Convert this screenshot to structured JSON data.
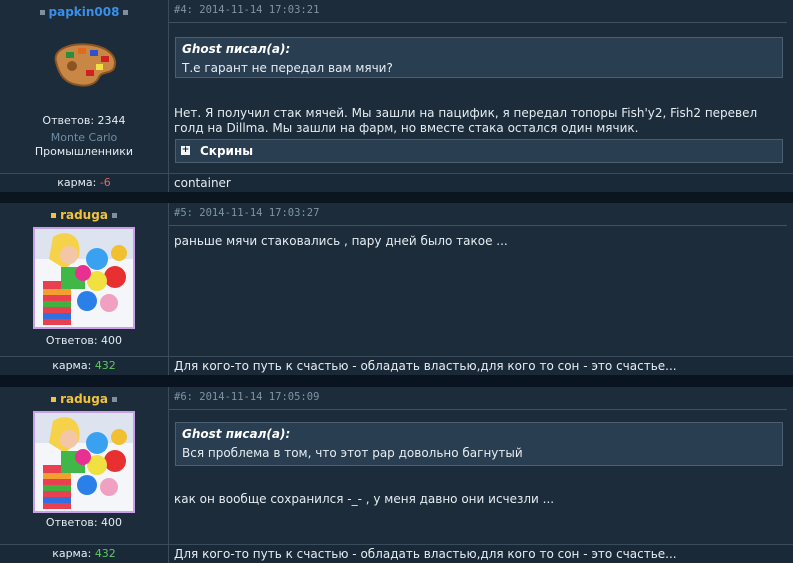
{
  "posts": [
    {
      "username": "papkin008",
      "username_color": "#3a8fe8",
      "avatar_icon": "palette-icon",
      "replies_label": "Ответов: 2344",
      "location": "Monte Carlo",
      "group": "Промышленники",
      "karma_label": "карма:",
      "karma_value": "-6",
      "karma_color": "#e06a60",
      "header": "#4: 2014-11-14 17:03:21",
      "quote": {
        "author": "Ghost писал(а):",
        "text": "Т.е гарант не передал вам мячи?"
      },
      "body": "Нет. Я получил стак мячей. Мы зашли на пацифик, я передал топоры Fish'y2, Fish2 перевел голд на Dillma. Мы зашли на фарм, но вместе стака остался один мячик.",
      "spoiler": "Скрины",
      "signature": "container"
    },
    {
      "username": "raduga",
      "username_color": "#f2c33a",
      "avatar_icon": "girl-with-balloons-avatar",
      "replies_label": "Ответов: 400",
      "karma_label": "карма:",
      "karma_value": "432",
      "karma_color": "#5ec85e",
      "header": "#5: 2014-11-14 17:03:27",
      "body": "раньше мячи стаковались , пару дней было такое ...",
      "signature": "Для кого-то путь к счастью - обладать властью,для кого то сон - это счастье..."
    },
    {
      "username": "raduga",
      "username_color": "#f2c33a",
      "avatar_icon": "girl-with-balloons-avatar",
      "replies_label": "Ответов: 400",
      "karma_label": "карма:",
      "karma_value": "432",
      "karma_color": "#5ec85e",
      "header": "#6: 2014-11-14 17:05:09",
      "quote": {
        "author": "Ghost писал(а):",
        "text": "Вся проблема в том, что этот рар довольно багнутый"
      },
      "body": "как он вообще сохранился -_- , у меня давно они исчезли ...",
      "signature": "Для кого-то путь к счастью - обладать властью,для кого то сон - это счастье..."
    }
  ]
}
